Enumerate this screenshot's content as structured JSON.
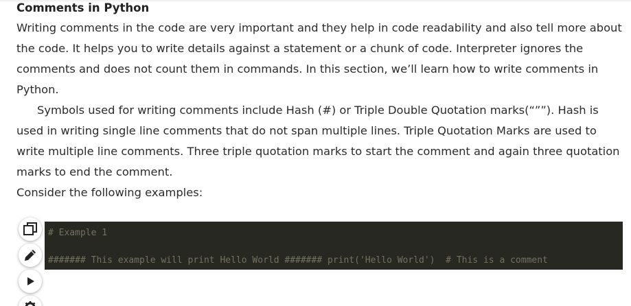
{
  "article": {
    "title": "Comments in Python",
    "paragraph_1": "Writing comments in the code are very important and they help in code readability and also tell more about the code. It helps you to write details against a statement or a chunk of code. Interpreter ignores the comments and does not count them in commands. In this section, we’ll learn how to write comments in Python.",
    "paragraph_2": "Symbols used for writing comments include Hash (#) or Triple Double Quotation marks(“””). Hash is used in writing single line comments that do not span multiple lines. Triple Quotation Marks are used to write multiple line comments. Three triple quotation marks to start the comment and again three quotation marks to end the comment.",
    "paragraph_3": "Consider the following examples:"
  },
  "code_toolbar": {
    "icons": [
      "copy-icon",
      "edit-icon",
      "run-icon",
      "settings-icon"
    ]
  },
  "code": {
    "line_1": "# Example 1",
    "line_2": "####### This example will print Hello World ####### print('Hello World')  # This is a comment",
    "background": "#272822",
    "comment_color": "#75715e"
  }
}
